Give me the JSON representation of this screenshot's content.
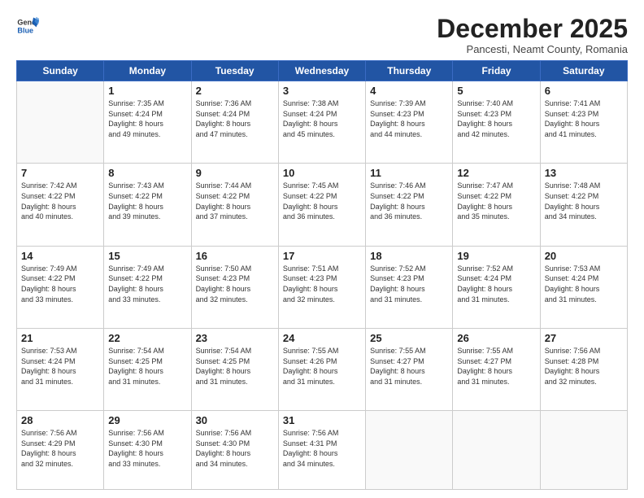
{
  "logo": {
    "line1": "General",
    "line2": "Blue"
  },
  "header": {
    "month": "December 2025",
    "location": "Pancesti, Neamt County, Romania"
  },
  "weekdays": [
    "Sunday",
    "Monday",
    "Tuesday",
    "Wednesday",
    "Thursday",
    "Friday",
    "Saturday"
  ],
  "weeks": [
    [
      {
        "day": "",
        "info": ""
      },
      {
        "day": "1",
        "info": "Sunrise: 7:35 AM\nSunset: 4:24 PM\nDaylight: 8 hours\nand 49 minutes."
      },
      {
        "day": "2",
        "info": "Sunrise: 7:36 AM\nSunset: 4:24 PM\nDaylight: 8 hours\nand 47 minutes."
      },
      {
        "day": "3",
        "info": "Sunrise: 7:38 AM\nSunset: 4:24 PM\nDaylight: 8 hours\nand 45 minutes."
      },
      {
        "day": "4",
        "info": "Sunrise: 7:39 AM\nSunset: 4:23 PM\nDaylight: 8 hours\nand 44 minutes."
      },
      {
        "day": "5",
        "info": "Sunrise: 7:40 AM\nSunset: 4:23 PM\nDaylight: 8 hours\nand 42 minutes."
      },
      {
        "day": "6",
        "info": "Sunrise: 7:41 AM\nSunset: 4:23 PM\nDaylight: 8 hours\nand 41 minutes."
      }
    ],
    [
      {
        "day": "7",
        "info": "Sunrise: 7:42 AM\nSunset: 4:22 PM\nDaylight: 8 hours\nand 40 minutes."
      },
      {
        "day": "8",
        "info": "Sunrise: 7:43 AM\nSunset: 4:22 PM\nDaylight: 8 hours\nand 39 minutes."
      },
      {
        "day": "9",
        "info": "Sunrise: 7:44 AM\nSunset: 4:22 PM\nDaylight: 8 hours\nand 37 minutes."
      },
      {
        "day": "10",
        "info": "Sunrise: 7:45 AM\nSunset: 4:22 PM\nDaylight: 8 hours\nand 36 minutes."
      },
      {
        "day": "11",
        "info": "Sunrise: 7:46 AM\nSunset: 4:22 PM\nDaylight: 8 hours\nand 36 minutes."
      },
      {
        "day": "12",
        "info": "Sunrise: 7:47 AM\nSunset: 4:22 PM\nDaylight: 8 hours\nand 35 minutes."
      },
      {
        "day": "13",
        "info": "Sunrise: 7:48 AM\nSunset: 4:22 PM\nDaylight: 8 hours\nand 34 minutes."
      }
    ],
    [
      {
        "day": "14",
        "info": "Sunrise: 7:49 AM\nSunset: 4:22 PM\nDaylight: 8 hours\nand 33 minutes."
      },
      {
        "day": "15",
        "info": "Sunrise: 7:49 AM\nSunset: 4:22 PM\nDaylight: 8 hours\nand 33 minutes."
      },
      {
        "day": "16",
        "info": "Sunrise: 7:50 AM\nSunset: 4:23 PM\nDaylight: 8 hours\nand 32 minutes."
      },
      {
        "day": "17",
        "info": "Sunrise: 7:51 AM\nSunset: 4:23 PM\nDaylight: 8 hours\nand 32 minutes."
      },
      {
        "day": "18",
        "info": "Sunrise: 7:52 AM\nSunset: 4:23 PM\nDaylight: 8 hours\nand 31 minutes."
      },
      {
        "day": "19",
        "info": "Sunrise: 7:52 AM\nSunset: 4:24 PM\nDaylight: 8 hours\nand 31 minutes."
      },
      {
        "day": "20",
        "info": "Sunrise: 7:53 AM\nSunset: 4:24 PM\nDaylight: 8 hours\nand 31 minutes."
      }
    ],
    [
      {
        "day": "21",
        "info": "Sunrise: 7:53 AM\nSunset: 4:24 PM\nDaylight: 8 hours\nand 31 minutes."
      },
      {
        "day": "22",
        "info": "Sunrise: 7:54 AM\nSunset: 4:25 PM\nDaylight: 8 hours\nand 31 minutes."
      },
      {
        "day": "23",
        "info": "Sunrise: 7:54 AM\nSunset: 4:25 PM\nDaylight: 8 hours\nand 31 minutes."
      },
      {
        "day": "24",
        "info": "Sunrise: 7:55 AM\nSunset: 4:26 PM\nDaylight: 8 hours\nand 31 minutes."
      },
      {
        "day": "25",
        "info": "Sunrise: 7:55 AM\nSunset: 4:27 PM\nDaylight: 8 hours\nand 31 minutes."
      },
      {
        "day": "26",
        "info": "Sunrise: 7:55 AM\nSunset: 4:27 PM\nDaylight: 8 hours\nand 31 minutes."
      },
      {
        "day": "27",
        "info": "Sunrise: 7:56 AM\nSunset: 4:28 PM\nDaylight: 8 hours\nand 32 minutes."
      }
    ],
    [
      {
        "day": "28",
        "info": "Sunrise: 7:56 AM\nSunset: 4:29 PM\nDaylight: 8 hours\nand 32 minutes."
      },
      {
        "day": "29",
        "info": "Sunrise: 7:56 AM\nSunset: 4:30 PM\nDaylight: 8 hours\nand 33 minutes."
      },
      {
        "day": "30",
        "info": "Sunrise: 7:56 AM\nSunset: 4:30 PM\nDaylight: 8 hours\nand 34 minutes."
      },
      {
        "day": "31",
        "info": "Sunrise: 7:56 AM\nSunset: 4:31 PM\nDaylight: 8 hours\nand 34 minutes."
      },
      {
        "day": "",
        "info": ""
      },
      {
        "day": "",
        "info": ""
      },
      {
        "day": "",
        "info": ""
      }
    ]
  ]
}
